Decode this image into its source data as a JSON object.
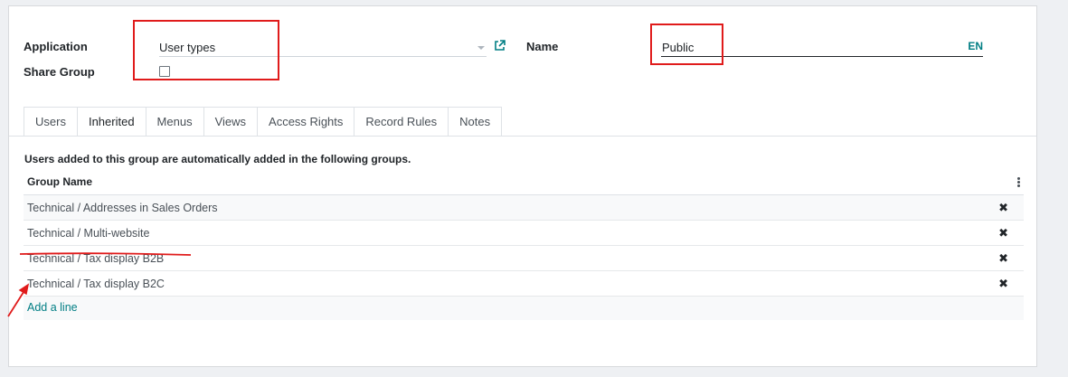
{
  "form": {
    "application_label": "Application",
    "application_value": "User types",
    "share_group_label": "Share Group",
    "share_group_checked": false,
    "name_label": "Name",
    "name_value": "Public",
    "lang_label": "EN"
  },
  "tabs": [
    {
      "label": "Users",
      "active": false
    },
    {
      "label": "Inherited",
      "active": true
    },
    {
      "label": "Menus",
      "active": false
    },
    {
      "label": "Views",
      "active": false
    },
    {
      "label": "Access Rights",
      "active": false
    },
    {
      "label": "Record Rules",
      "active": false
    },
    {
      "label": "Notes",
      "active": false
    }
  ],
  "inherited": {
    "info_text": "Users added to this group are automatically added in the following groups.",
    "column_header": "Group Name",
    "rows": [
      "Technical / Addresses in Sales Orders",
      "Technical / Multi-website",
      "Technical / Tax display B2B",
      "Technical / Tax display B2C"
    ],
    "add_line": "Add a line"
  },
  "icons": {
    "external_link": "external-link-icon",
    "delete": "close-icon",
    "options": "kebab-menu-icon",
    "dropdown": "chevron-down-icon"
  },
  "colors": {
    "accent": "#017e84",
    "annotation": "#e01b1b"
  }
}
